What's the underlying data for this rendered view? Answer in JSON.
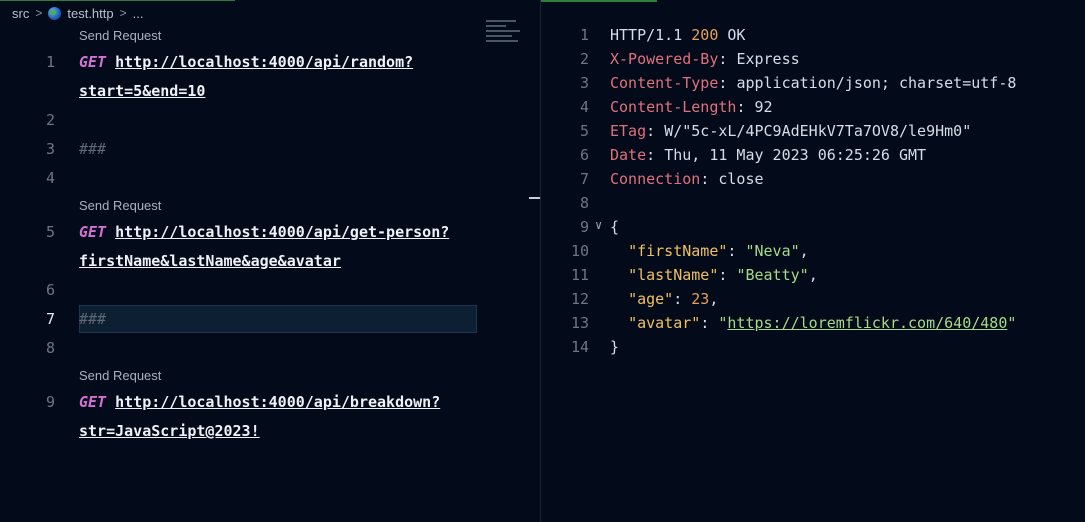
{
  "breadcrumb": {
    "folder": "src",
    "file": "test.http",
    "more": "..."
  },
  "request_file": {
    "codelens_label": "Send Request",
    "lines": [
      {
        "number": "1",
        "method": "GET",
        "url_part1": "http://localhost:4000/api/random?",
        "url_part2": "start=5&end=10"
      },
      {
        "number": "2"
      },
      {
        "number": "3",
        "comment": "###"
      },
      {
        "number": "4"
      },
      {
        "number": "5",
        "method": "GET",
        "url_part1": "http://localhost:4000/api/get-person?",
        "url_part2": "firstName&lastName&age&avatar"
      },
      {
        "number": "6"
      },
      {
        "number": "7",
        "comment": "###",
        "active": true
      },
      {
        "number": "8"
      },
      {
        "number": "9",
        "method": "GET",
        "url_part1": "http://localhost:4000/api/breakdown?",
        "url_part2": "str=JavaScript@2023!"
      }
    ]
  },
  "response": {
    "status_line": {
      "protocol": "HTTP/1.1",
      "code": "200",
      "text": "OK"
    },
    "headers": [
      {
        "key": "X-Powered-By",
        "value": "Express"
      },
      {
        "key": "Content-Type",
        "value": "application/json; charset=utf-8"
      },
      {
        "key": "Content-Length",
        "value": "92"
      },
      {
        "key": "ETag",
        "value": "W/\"5c-xL/4PC9AdEHkV7Ta7OV8/le9Hm0\""
      },
      {
        "key": "Date",
        "value": "Thu, 11 May 2023 06:25:26 GMT"
      },
      {
        "key": "Connection",
        "value": "close"
      }
    ],
    "line_numbers": [
      "1",
      "2",
      "3",
      "4",
      "5",
      "6",
      "7",
      "8",
      "9",
      "10",
      "11",
      "12",
      "13",
      "14"
    ],
    "body": {
      "open": "{",
      "close": "}",
      "fields": [
        {
          "key": "\"firstName\"",
          "value": "\"Neva\"",
          "type": "string",
          "comma": ","
        },
        {
          "key": "\"lastName\"",
          "value": "\"Beatty\"",
          "type": "string",
          "comma": ","
        },
        {
          "key": "\"age\"",
          "value": "23",
          "type": "number",
          "comma": ","
        },
        {
          "key": "\"avatar\"",
          "value": "https://loremflickr.com/640/480",
          "type": "link",
          "comma": ""
        }
      ]
    }
  }
}
